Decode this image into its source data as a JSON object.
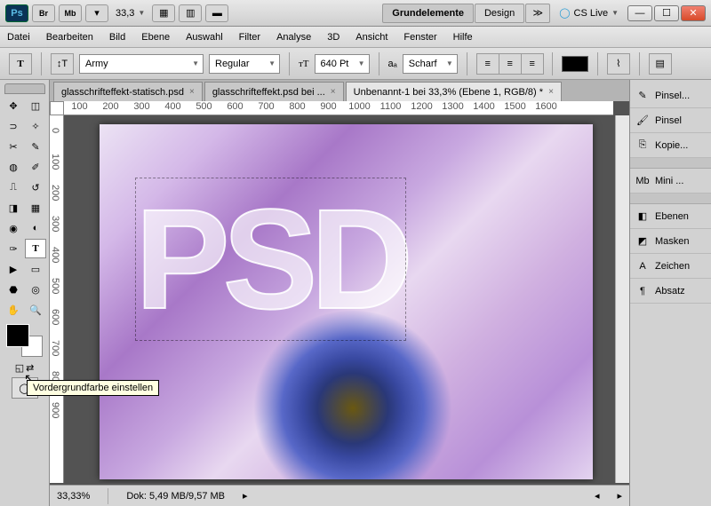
{
  "titlebar": {
    "ps_label": "Ps",
    "br_label": "Br",
    "mb_label": "Mb",
    "zoom_value": "33,3",
    "ws_essentials": "Grundelemente",
    "ws_design": "Design",
    "cslive_label": "CS Live"
  },
  "menu": {
    "items": [
      "Datei",
      "Bearbeiten",
      "Bild",
      "Ebene",
      "Auswahl",
      "Filter",
      "Analyse",
      "3D",
      "Ansicht",
      "Fenster",
      "Hilfe"
    ]
  },
  "options": {
    "font_family": "Army",
    "font_style": "Regular",
    "size_value": "640 Pt",
    "aa_prefix": "aₐ",
    "aa_label": "Scharf"
  },
  "doctabs": [
    {
      "label": "glasschrifteffekt-statisch.psd",
      "active": false
    },
    {
      "label": "glasschrifteffekt.psd bei ...",
      "active": false
    },
    {
      "label": "Unbenannt-1 bei 33,3% (Ebene 1, RGB/8) *",
      "active": true
    }
  ],
  "ruler_h": [
    "100",
    "200",
    "300",
    "400",
    "500",
    "600",
    "700",
    "800",
    "900",
    "1000",
    "1100",
    "1200",
    "1300",
    "1400",
    "1500",
    "1600"
  ],
  "ruler_v": [
    "0",
    "100",
    "200",
    "300",
    "400",
    "500",
    "600",
    "700",
    "800",
    "900"
  ],
  "canvas_text": "PSD",
  "status": {
    "zoom": "33,33%",
    "docsize_label": "Dok:",
    "docsize_value": "5,49 MB/9,57 MB"
  },
  "panels": [
    {
      "icon": "brush",
      "label": "Pinsel..."
    },
    {
      "icon": "brush2",
      "label": "Pinsel"
    },
    {
      "icon": "clone",
      "label": "Kopie..."
    },
    {
      "gap": true
    },
    {
      "icon": "mb",
      "label": "Mini ..."
    },
    {
      "gap": true
    },
    {
      "icon": "layers",
      "label": "Ebenen"
    },
    {
      "icon": "mask",
      "label": "Masken"
    },
    {
      "icon": "char",
      "label": "Zeichen"
    },
    {
      "icon": "para",
      "label": "Absatz"
    }
  ],
  "tooltip": "Vordergrundfarbe einstellen",
  "colors": {
    "accent": "#2a5db0"
  }
}
